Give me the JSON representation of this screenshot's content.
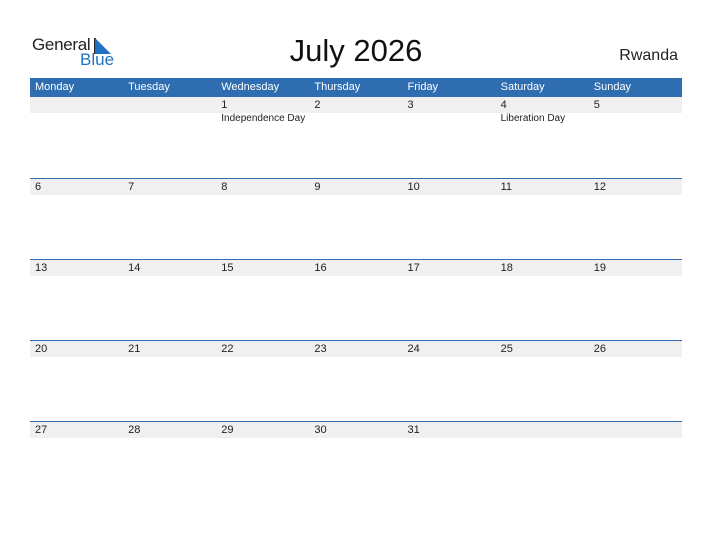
{
  "logo": {
    "general": "General",
    "blue": "Blue"
  },
  "title": "July 2026",
  "country": "Rwanda",
  "colors": {
    "header": "#2e6db0",
    "band": "#f0f0f0",
    "accent": "#1f73c4"
  },
  "weekdays": [
    "Monday",
    "Tuesday",
    "Wednesday",
    "Thursday",
    "Friday",
    "Saturday",
    "Sunday"
  ],
  "weeks": [
    {
      "days": [
        "",
        "",
        "1",
        "2",
        "3",
        "4",
        "5"
      ],
      "events": [
        "",
        "",
        "Independence Day",
        "",
        "",
        "Liberation Day",
        ""
      ]
    },
    {
      "days": [
        "6",
        "7",
        "8",
        "9",
        "10",
        "11",
        "12"
      ],
      "events": [
        "",
        "",
        "",
        "",
        "",
        "",
        ""
      ]
    },
    {
      "days": [
        "13",
        "14",
        "15",
        "16",
        "17",
        "18",
        "19"
      ],
      "events": [
        "",
        "",
        "",
        "",
        "",
        "",
        ""
      ]
    },
    {
      "days": [
        "20",
        "21",
        "22",
        "23",
        "24",
        "25",
        "26"
      ],
      "events": [
        "",
        "",
        "",
        "",
        "",
        "",
        ""
      ]
    },
    {
      "days": [
        "27",
        "28",
        "29",
        "30",
        "31",
        "",
        ""
      ],
      "events": [
        "",
        "",
        "",
        "",
        "",
        "",
        ""
      ]
    }
  ]
}
